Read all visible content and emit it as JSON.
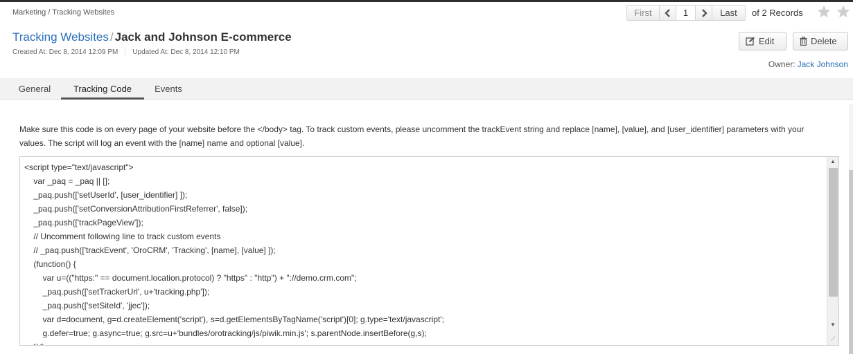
{
  "breadcrumb": "Marketing / Tracking Websites",
  "pager": {
    "first": "First",
    "page": "1",
    "last": "Last",
    "records": "of 2 Records"
  },
  "title": {
    "parent": "Tracking Websites",
    "separator": "/",
    "name": "Jack and Johnson E-commerce"
  },
  "meta": {
    "created": "Created At: Dec 8, 2014 12:09 PM",
    "updated": "Updated At: Dec 8, 2014 12:10 PM"
  },
  "actions": {
    "edit": "Edit",
    "delete": "Delete"
  },
  "owner": {
    "label": "Owner:",
    "name": "Jack Johnson"
  },
  "tabs": [
    {
      "label": "General"
    },
    {
      "label": "Tracking Code",
      "active": true
    },
    {
      "label": "Events"
    }
  ],
  "description": "Make sure this code is on every page of your website before the </body> tag. To track custom events, please uncomment the trackEvent string and replace [name], [value], and [user_identifier] parameters with your values. The script will log an event with the [name] name and optional [value].",
  "code_lines": [
    "<script type=\"text/javascript\">",
    "    var _paq = _paq || [];",
    "    _paq.push(['setUserId', [user_identifier] ]);",
    "    _paq.push(['setConversionAttributionFirstReferrer', false]);",
    "    _paq.push(['trackPageView']);",
    "    // Uncomment following line to track custom events",
    "    // _paq.push(['trackEvent', 'OroCRM', 'Tracking', [name], [value] ]);",
    "    (function() {",
    "        var u=((\"https:\" == document.location.protocol) ? \"https\" : \"http\") + \"://demo.crm.com\";",
    "        _paq.push(['setTrackerUrl', u+'tracking.php']);",
    "        _paq.push(['setSiteId', 'jjec']);",
    "        var d=document, g=d.createElement('script'), s=d.getElementsByTagName('script')[0]; g.type='text/javascript';",
    "        g.defer=true; g.async=true; g.src=u+'bundles/orotracking/js/piwik.min.js'; s.parentNode.insertBefore(g,s);",
    "    })();"
  ],
  "colors": {
    "link": "#2a6ebb",
    "active_tab_underline": "#555555",
    "tab_bar": "#f2f2f2"
  },
  "icons": [
    "chevron-left-icon",
    "chevron-right-icon",
    "star-icon",
    "edit-icon",
    "trash-icon"
  ]
}
